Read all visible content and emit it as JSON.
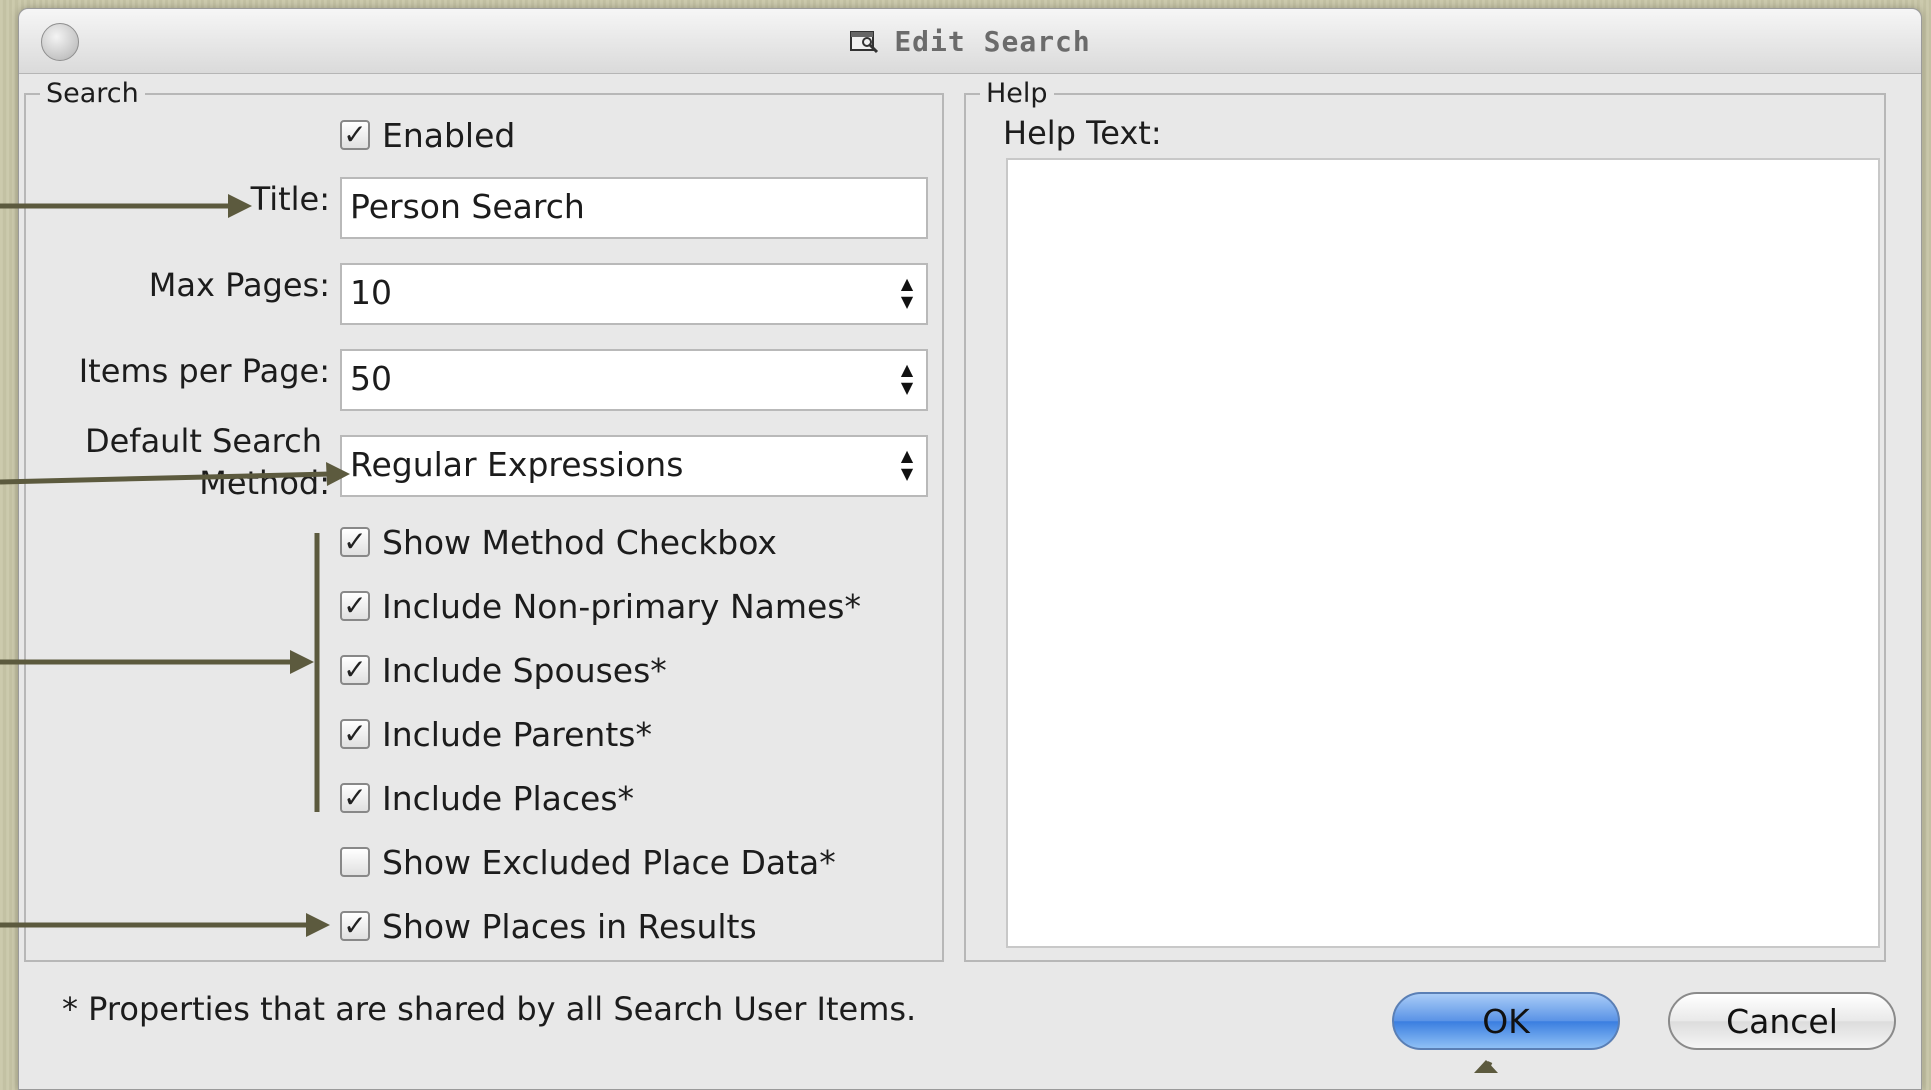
{
  "window": {
    "title": "Edit Search"
  },
  "search_group": {
    "legend": "Search",
    "enabled": {
      "label": "Enabled",
      "checked": true
    },
    "title_label": "Title:",
    "title_value": "Person Search",
    "max_pages_label": "Max Pages:",
    "max_pages_value": "10",
    "items_per_page_label": "Items per Page:",
    "items_per_page_value": "50",
    "default_method_label_line1": "Default Search",
    "default_method_label_line2": "Method:",
    "default_method_value": "Regular Expressions",
    "checkboxes": [
      {
        "label": "Show Method Checkbox",
        "checked": true
      },
      {
        "label": "Include Non-primary Names*",
        "checked": true
      },
      {
        "label": "Include Spouses*",
        "checked": true
      },
      {
        "label": "Include Parents*",
        "checked": true
      },
      {
        "label": "Include Places*",
        "checked": true
      },
      {
        "label": "Show Excluded Place Data*",
        "checked": false
      },
      {
        "label": "Show Places in Results",
        "checked": true
      }
    ]
  },
  "help_group": {
    "legend": "Help",
    "help_text_label": "Help Text:",
    "help_text_value": ""
  },
  "footnote": "* Properties that are shared by all Search User Items.",
  "buttons": {
    "ok": "OK",
    "cancel": "Cancel"
  },
  "colors": {
    "arrow": "#5c5a3e",
    "ok_blue": "#3a7ee0"
  }
}
